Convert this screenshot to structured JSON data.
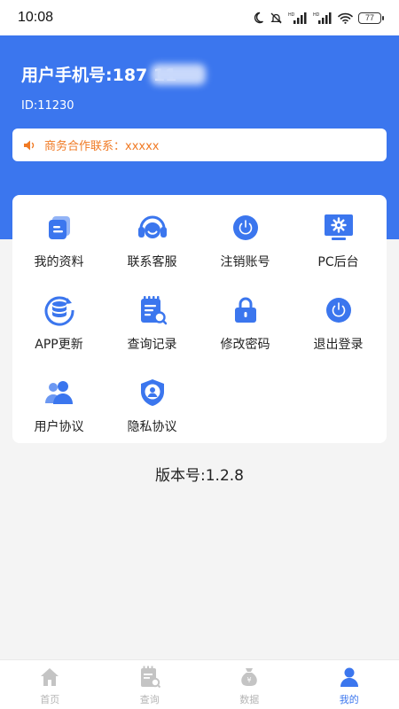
{
  "status_bar": {
    "time": "10:08",
    "battery": "77"
  },
  "profile": {
    "phone_label": "用户手机号:187        11",
    "id_label": "ID:11230"
  },
  "notice": {
    "text": "商务合作联系：xxxxx"
  },
  "menu": {
    "items": [
      {
        "label": "我的资料",
        "icon": "profile-card-icon"
      },
      {
        "label": "联系客服",
        "icon": "headset-icon"
      },
      {
        "label": "注销账号",
        "icon": "power-icon"
      },
      {
        "label": "PC后台",
        "icon": "monitor-gear-icon"
      },
      {
        "label": "APP更新",
        "icon": "database-refresh-icon"
      },
      {
        "label": "查询记录",
        "icon": "clipboard-search-icon"
      },
      {
        "label": "修改密码",
        "icon": "lock-icon"
      },
      {
        "label": "退出登录",
        "icon": "power-icon"
      },
      {
        "label": "用户协议",
        "icon": "users-icon"
      },
      {
        "label": "隐私协议",
        "icon": "shield-user-icon"
      }
    ]
  },
  "version": {
    "label": "版本号:1.2.8"
  },
  "tabbar": {
    "items": [
      {
        "label": "首页",
        "icon": "home-icon",
        "active": false
      },
      {
        "label": "查询",
        "icon": "clipboard-search-icon",
        "active": false
      },
      {
        "label": "数据",
        "icon": "money-bag-icon",
        "active": false
      },
      {
        "label": "我的",
        "icon": "user-icon",
        "active": true
      }
    ]
  },
  "colors": {
    "primary": "#3b76ee",
    "notice_text": "#f07a24",
    "tab_inactive": "#b5b5b5"
  }
}
